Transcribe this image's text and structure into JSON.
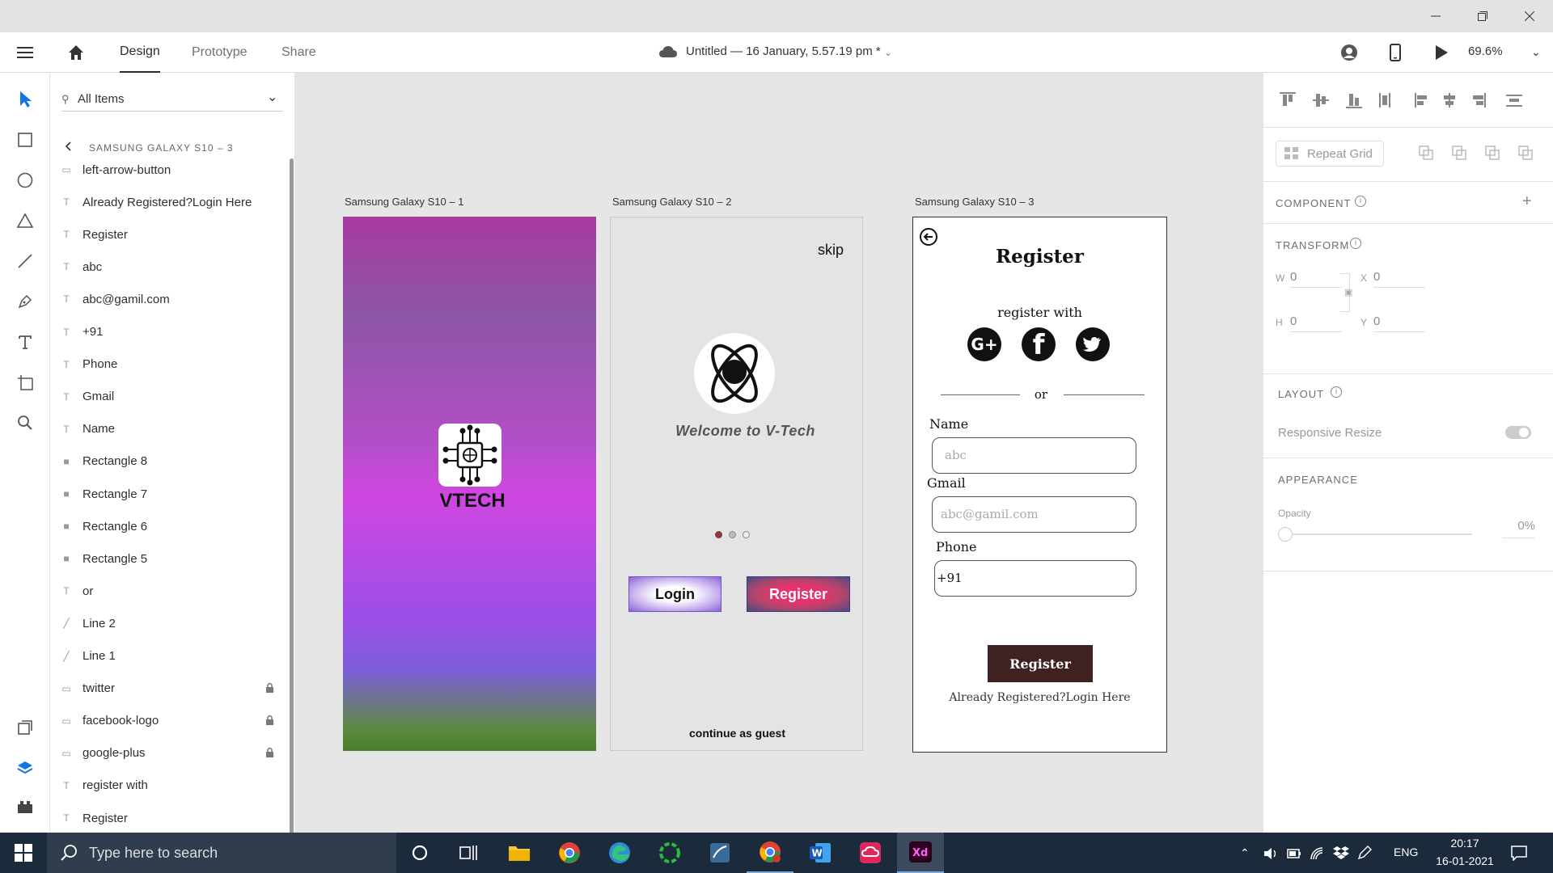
{
  "menubar": {
    "design": "Design",
    "prototype": "Prototype",
    "share": "Share",
    "doc_title": "Untitled — 16 January, 5.57.19 pm *",
    "zoom": "69.6%"
  },
  "layers": {
    "search_placeholder": "All Items",
    "breadcrumb": "SAMSUNG GALAXY S10 – 3",
    "items": [
      {
        "label": "left-arrow-button",
        "icon": "image-icon"
      },
      {
        "label": "Already Registered?Login Here",
        "icon": "text-icon"
      },
      {
        "label": "Register",
        "icon": "text-icon"
      },
      {
        "label": "abc",
        "icon": "text-icon"
      },
      {
        "label": "abc@gamil.com",
        "icon": "text-icon"
      },
      {
        "label": "+91",
        "icon": "text-icon"
      },
      {
        "label": "Phone",
        "icon": "text-icon"
      },
      {
        "label": "Gmail",
        "icon": "text-icon"
      },
      {
        "label": "Name",
        "icon": "text-icon"
      },
      {
        "label": "Rectangle 8",
        "icon": "rectangle-icon"
      },
      {
        "label": "Rectangle 7",
        "icon": "rectangle-icon"
      },
      {
        "label": "Rectangle 6",
        "icon": "rectangle-icon"
      },
      {
        "label": "Rectangle 5",
        "icon": "rectangle-icon"
      },
      {
        "label": "or",
        "icon": "text-icon"
      },
      {
        "label": "Line 2",
        "icon": "line-icon"
      },
      {
        "label": "Line 1",
        "icon": "line-icon"
      },
      {
        "label": "twitter",
        "icon": "image-icon",
        "locked": true
      },
      {
        "label": "facebook-logo",
        "icon": "image-icon",
        "locked": true
      },
      {
        "label": "google-plus",
        "icon": "image-icon",
        "locked": true
      },
      {
        "label": "register with",
        "icon": "text-icon"
      },
      {
        "label": "Register",
        "icon": "text-icon"
      }
    ]
  },
  "artboards": {
    "a1": {
      "label": "Samsung Galaxy S10 – 1",
      "logo_text": "VTECH"
    },
    "a2": {
      "label": "Samsung Galaxy S10 – 2",
      "skip": "skip",
      "welcome": "Welcome to V-Tech",
      "login": "Login",
      "register": "Register",
      "guest": "continue as guest"
    },
    "a3": {
      "label": "Samsung Galaxy S10 – 3",
      "title": "Register",
      "register_with": "register with",
      "or": "or",
      "name_label": "Name",
      "name_placeholder": "abc",
      "gmail_label": "Gmail",
      "gmail_placeholder": "abc@gamil.com",
      "phone_label": "Phone",
      "phone_value": "+91",
      "button": "Register",
      "footer": "Already Registered?Login Here"
    }
  },
  "props": {
    "repeat_grid": "Repeat Grid",
    "component": "COMPONENT",
    "transform": "TRANSFORM",
    "w_label": "W",
    "w": "0",
    "x_label": "X",
    "x": "0",
    "h_label": "H",
    "h": "0",
    "y_label": "Y",
    "y": "0",
    "layout": "LAYOUT",
    "responsive": "Responsive Resize",
    "appearance": "APPEARANCE",
    "opacity_label": "Opacity",
    "opacity": "0%"
  },
  "taskbar": {
    "search_placeholder": "Type here to search",
    "lang": "ENG",
    "time": "20:17",
    "date": "16-01-2021"
  },
  "colors": {
    "accent_blue": "#1473e6",
    "register_btn": "#3f2121",
    "taskbar": "#1c2b3b"
  }
}
